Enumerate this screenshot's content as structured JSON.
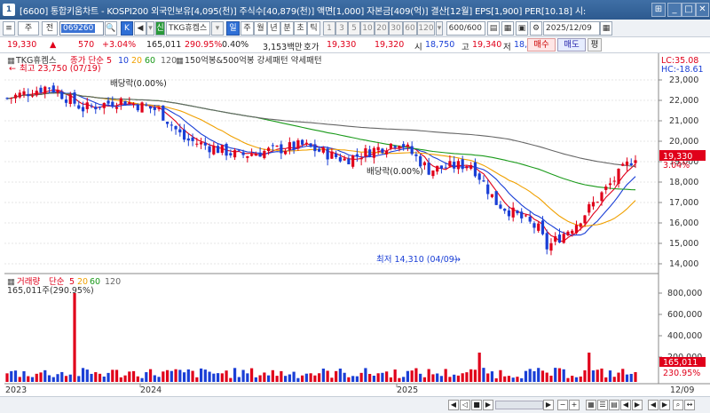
{
  "window": {
    "number": "1",
    "title": "[6600] 통합키움차트 - KOSPI200 외국인보유[4,095(천)] 주식수[40,879(천)] 액면[1,000] 자본금[409(억)] 결산[12월] EPS[1,900] PER[10.18] 시:"
  },
  "toolbar": {
    "period_a": "주",
    "period_b": "전",
    "code": "069260",
    "k_label": "K",
    "stock_name": "TKG휴켐스",
    "sel_label": "신",
    "periods": [
      "일",
      "주",
      "월",
      "년",
      "분",
      "초",
      "틱"
    ],
    "numbers": [
      "1",
      "3",
      "5",
      "10",
      "20",
      "30",
      "60",
      "120"
    ],
    "count": "600/600",
    "date": "2025/12/09"
  },
  "quote": {
    "price": "19,330",
    "up_mark": "▲",
    "change": "570",
    "pct": "+3.04%",
    "volume": "165,011",
    "vol_pct": "290.95%",
    "turnover_pct": "0.40%",
    "amount": "3,153백만",
    "hoga_label": "호가",
    "ask": "19,330",
    "bid": "19,320",
    "open_label": "시",
    "open": "18,750",
    "high_label": "고",
    "high": "19,340",
    "low_label": "저",
    "low": "18,630",
    "buy": "매수",
    "sell": "매도",
    "eval": "평"
  },
  "chart": {
    "legend_main": [
      "TKG휴켐스",
      "종가 단순",
      "5",
      "10",
      "20",
      "60",
      "120"
    ],
    "legend_extra": "150억봉&500억봉 강세패턴  약세패턴",
    "max_label": "최고 23,750 (07/19)",
    "dividend_label_1": "배당락(0.00%)",
    "dividend_label_2": "배당락(0.00%)",
    "min_label": "최저 14,310 (04/09)",
    "lc": "LC:35.08",
    "hc": "HC:-18.61",
    "price_ticks": [
      "23,000",
      "22,000",
      "21,000",
      "20,000",
      "19,000",
      "18,000",
      "17,000",
      "16,000",
      "15,000",
      "14,000"
    ],
    "last_price": "19,330",
    "last_pct": "3.04%",
    "vol_legend": [
      "거래량",
      "단순",
      "5",
      "20",
      "60",
      "120"
    ],
    "vol_sub": "165,011주(290.95%)",
    "vol_ticks": [
      "800,000",
      "600,000",
      "400,000",
      "200,000"
    ],
    "last_vol": "165,011",
    "last_vol_pct": "230.95%",
    "x_labels": [
      "2023",
      "2024",
      "2025",
      "12/09"
    ],
    "colors": {
      "up": "#e0001a",
      "down": "#1a3fd6",
      "ma5": "#e0001a",
      "ma10": "#1a3fd6",
      "ma20": "#f0a000",
      "ma60": "#1a9a1a",
      "ma120": "#666666"
    }
  }
}
